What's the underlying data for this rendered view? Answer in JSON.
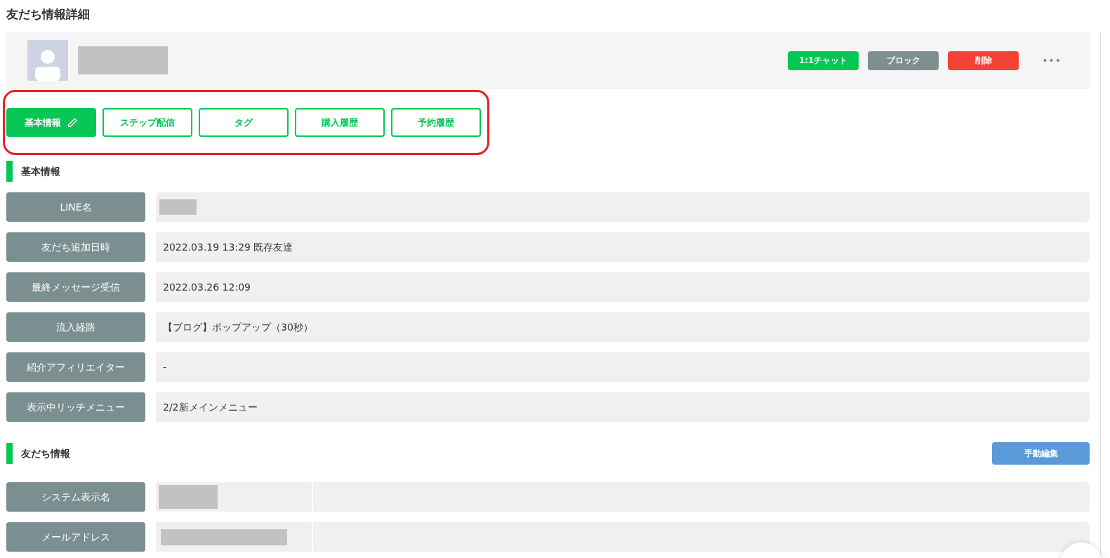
{
  "page_title": "友だち情報詳細",
  "profile": {
    "name_redacted": true,
    "actions": [
      {
        "label": "1:1チャット",
        "kind": "chat"
      },
      {
        "label": "ブロック",
        "kind": "block"
      },
      {
        "label": "削除",
        "kind": "delete"
      }
    ],
    "more_menu": "•••"
  },
  "tabs": [
    {
      "label": "基本情報",
      "selected": true,
      "editable": true
    },
    {
      "label": "ステップ配信",
      "selected": false,
      "editable": false
    },
    {
      "label": "タグ",
      "selected": false,
      "editable": false
    },
    {
      "label": "購入履歴",
      "selected": false,
      "editable": false
    },
    {
      "label": "予約履歴",
      "selected": false,
      "editable": false
    }
  ],
  "basic_info": {
    "heading": "基本情報",
    "rows": [
      {
        "label": "LINE名",
        "redacted": true
      },
      {
        "label": "友だち追加日時",
        "value": "2022.03.19 13:29 既存友達",
        "redacted": false
      },
      {
        "label": "最終メッセージ受信",
        "value": "2022.03.26 12:09",
        "redacted": false
      },
      {
        "label": "流入経路",
        "value": "【ブログ】ポップアップ（30秒）",
        "redacted": false
      },
      {
        "label": "紹介アフィリエイター",
        "value": "-",
        "redacted": false
      },
      {
        "label": "表示中リッチメニュー",
        "value": "2/2新メインメニュー",
        "redacted": false
      }
    ]
  },
  "friend_info": {
    "heading": "友だち情報",
    "edit_button": "手動編集",
    "rows": [
      {
        "label": "システム表示名",
        "redacted": true
      },
      {
        "label": "メールアドレス",
        "redacted": true
      }
    ]
  }
}
